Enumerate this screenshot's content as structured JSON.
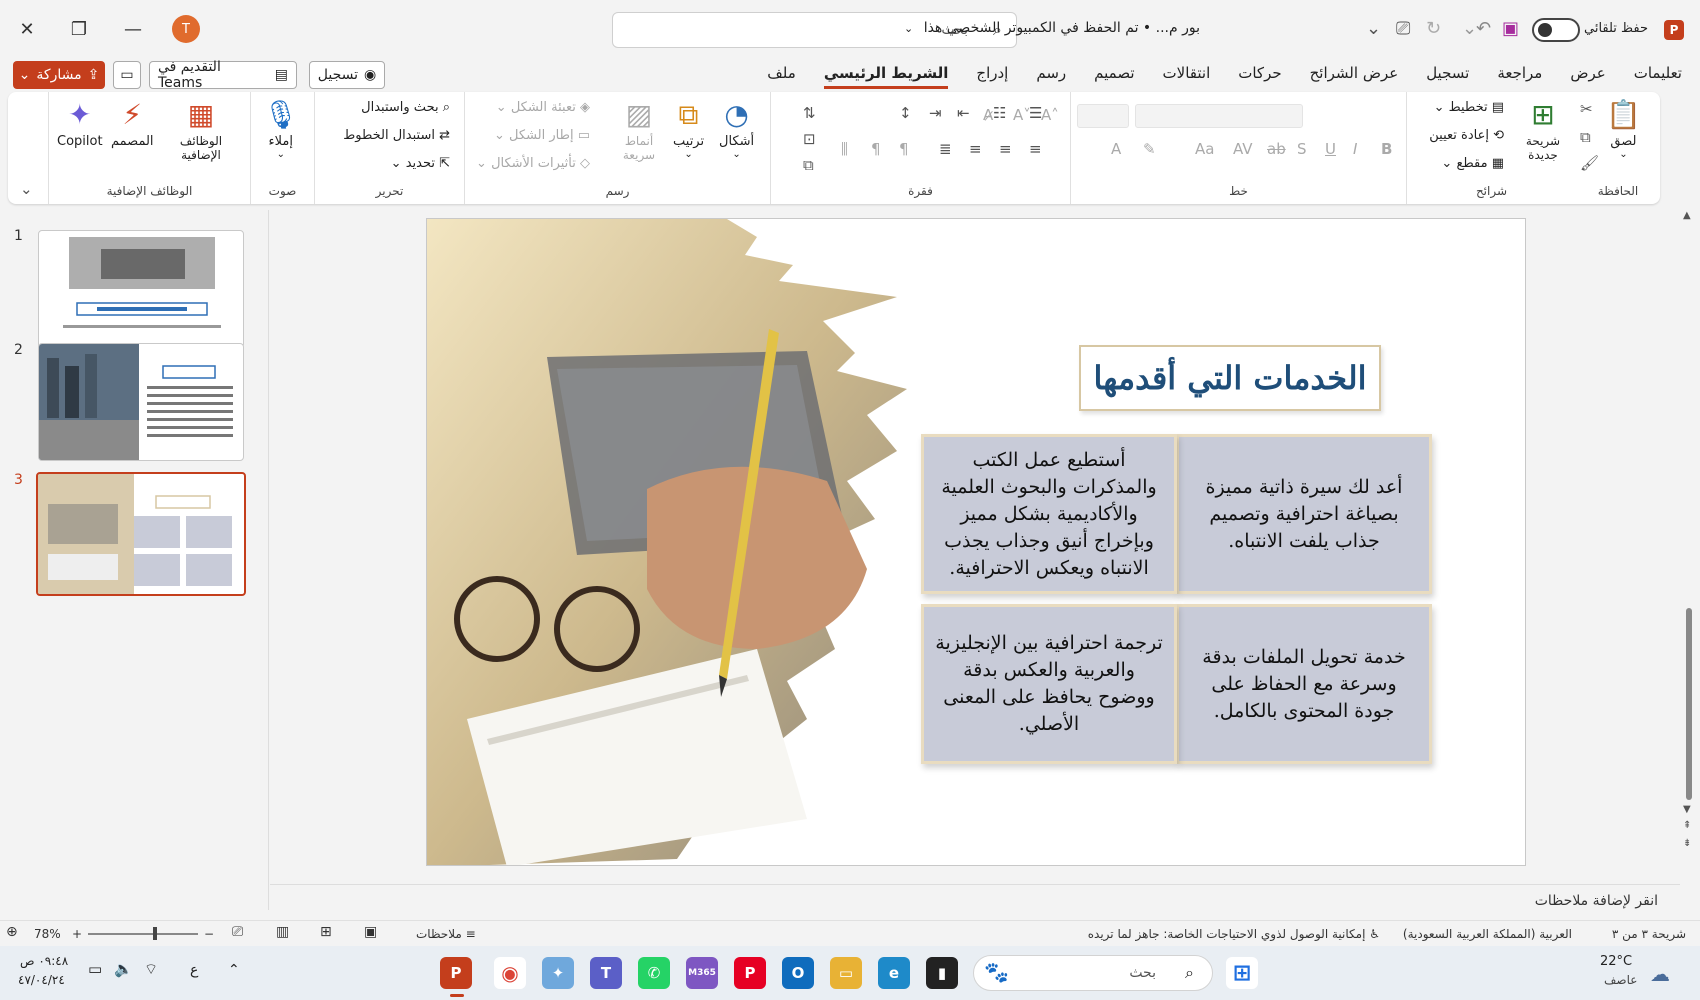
{
  "titlebar": {
    "search_placeholder": "بحث",
    "document_title": "بور م...  •  تم الحفظ في الكمبيوتر الشخصي هذا",
    "autosave_label": "حفظ تلقائي",
    "avatar_initial": "T",
    "autosave_state": "off"
  },
  "actions": {
    "share": "مشاركة",
    "teams": "التقديم في Teams",
    "record": "تسجيل"
  },
  "tabs": [
    {
      "label": "ملف",
      "active": false
    },
    {
      "label": "الشريط الرئيسي",
      "active": true
    },
    {
      "label": "إدراج",
      "active": false
    },
    {
      "label": "رسم",
      "active": false
    },
    {
      "label": "تصميم",
      "active": false
    },
    {
      "label": "انتقالات",
      "active": false
    },
    {
      "label": "حركات",
      "active": false
    },
    {
      "label": "عرض الشرائح",
      "active": false
    },
    {
      "label": "تسجيل",
      "active": false
    },
    {
      "label": "مراجعة",
      "active": false
    },
    {
      "label": "عرض",
      "active": false
    },
    {
      "label": "تعليمات",
      "active": false
    }
  ],
  "ribbon": {
    "clipboard": {
      "label": "الحافظة",
      "paste": "لصق"
    },
    "slides": {
      "label": "شرائح",
      "new_slide": "شريحة جديدة",
      "layout": "تخطيط",
      "reset": "إعادة تعيين",
      "section": "مقطع"
    },
    "font": {
      "label": "خط"
    },
    "paragraph": {
      "label": "فقرة"
    },
    "drawing": {
      "label": "رسم",
      "shapes": "أشكال",
      "arrange": "ترتيب",
      "quick_styles": "أنماط سريعة",
      "shape_fill": "تعبئة الشكل",
      "shape_outline": "إطار الشكل",
      "shape_effects": "تأثيرات الأشكال"
    },
    "editing": {
      "label": "تحرير",
      "find": "بحث واستبدال",
      "replace_fonts": "استبدال الخطوط",
      "select": "تحديد"
    },
    "voice": {
      "label": "صوت",
      "dictate": "إملاء"
    },
    "addins": {
      "label": "الوظائف الإضافية",
      "addins": "الوظائف الإضافية",
      "designer": "المصمم",
      "copilot": "Copilot"
    }
  },
  "thumbnails": [
    {
      "number": "1",
      "selected": false
    },
    {
      "number": "2",
      "selected": false
    },
    {
      "number": "3",
      "selected": true
    }
  ],
  "slide": {
    "title": "الخدمات التي أقدمها",
    "cards": [
      "أعد لك سيرة ذاتية مميزة بصياغة احترافية وتصميم جذاب يلفت الانتباه.",
      "أستطيع عمل الكتب والمذكرات والبحوث العلمية والأكاديمية بشكل مميز وبإخراج أنيق وجذاب يجذب الانتباه ويعكس الاحترافية.",
      "خدمة تحويل الملفات بدقة وسرعة مع الحفاظ على جودة المحتوى بالكامل.",
      "ترجمة احترافية بين الإنجليزية والعربية والعكس بدقة ووضوح يحافظ على المعنى الأصلي."
    ]
  },
  "notes": {
    "placeholder": "انقر لإضافة ملاحظات"
  },
  "statusbar": {
    "slide_counter": "شريحة ٣ من ٣",
    "language": "العربية (المملكة العربية السعودية)",
    "accessibility": "إمكانية الوصول لذوي الاحتياجات الخاصة: جاهز لما تريده",
    "notes_button": "ملاحظات",
    "zoom": "78%"
  },
  "taskbar": {
    "weather_temp": "22°C",
    "weather_desc": "عاصف",
    "search_placeholder": "بحث",
    "time": "٠٩:٤٨ ص",
    "date": "٤٧/٠٤/٢٤",
    "lang": "ع"
  },
  "colors": {
    "accent": "#c43e1c",
    "title_blue": "#1f4e79",
    "card_fill": "#c8cbd8",
    "card_border": "#e9dcc0"
  }
}
